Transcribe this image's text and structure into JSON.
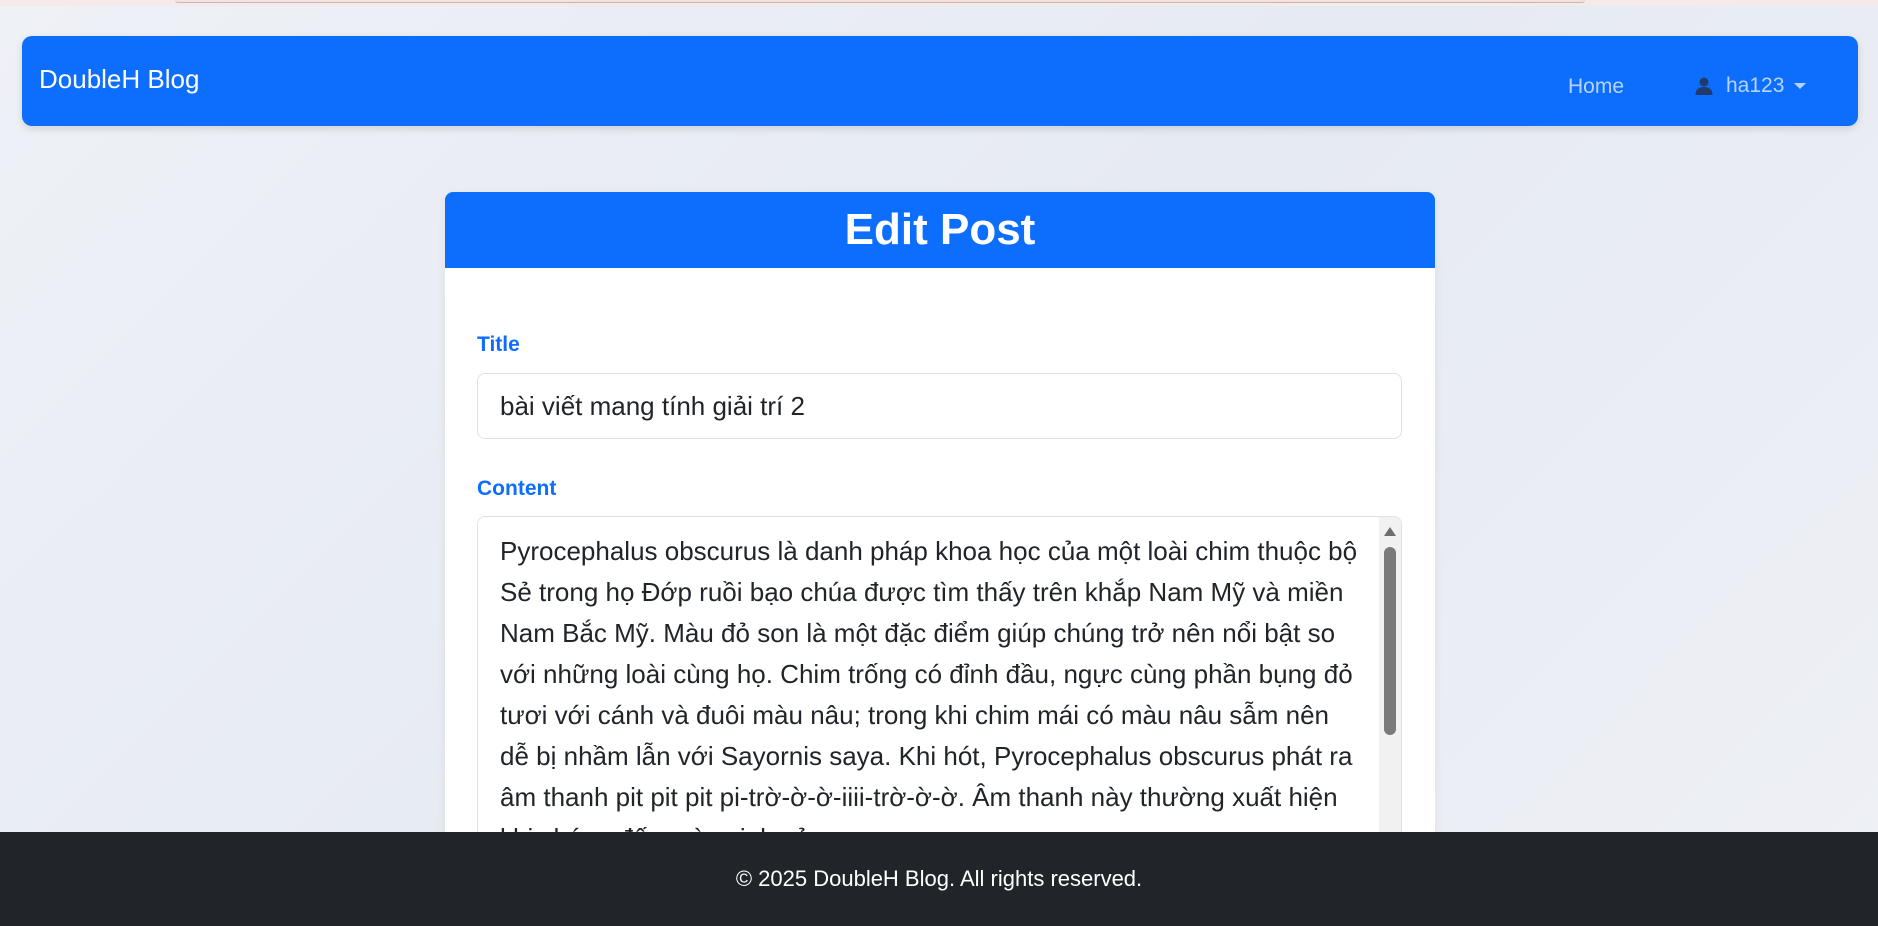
{
  "nav": {
    "brand": "DoubleH Blog",
    "home": "Home",
    "user": "ha123",
    "user_icon": "user-icon"
  },
  "card": {
    "header": "Edit Post",
    "title_label": "Title",
    "title_value": "bài viết mang tính giải trí 2",
    "content_label": "Content",
    "content_value": "Pyrocephalus obscurus là danh pháp khoa học của một loài chim thuộc bộ Sẻ trong họ Đớp ruồi bạo chúa được tìm thấy trên khắp Nam Mỹ và miền Nam Bắc Mỹ. Màu đỏ son là một đặc điểm giúp chúng trở nên nổi bật so với những loài cùng họ. Chim trống có đỉnh đầu, ngực cùng phần bụng đỏ tươi với cánh và đuôi màu nâu; trong khi chim mái có màu nâu sẫm nên dễ bị nhầm lẫn với Sayornis saya. Khi hót, Pyrocephalus obscurus phát ra âm thanh pit pit pit pi-trờ-ờ-ờ-iiii-trờ-ờ-ờ. Âm thanh này thường xuất hiện khi chúng đến mùa sinh sản."
  },
  "footer": {
    "text": "© 2025 DoubleH Blog. All rights reserved."
  }
}
